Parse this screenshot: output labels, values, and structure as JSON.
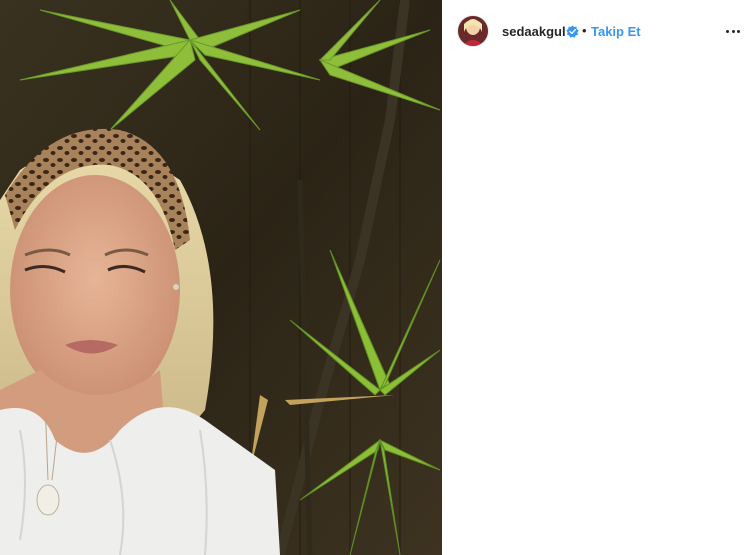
{
  "post": {
    "username": "sedaakgul",
    "separator": "•",
    "follow_label": "Takip Et",
    "verified_icon": "verified-badge-icon",
    "more_icon": "more-options-icon",
    "accent_color": "#3897f0"
  }
}
